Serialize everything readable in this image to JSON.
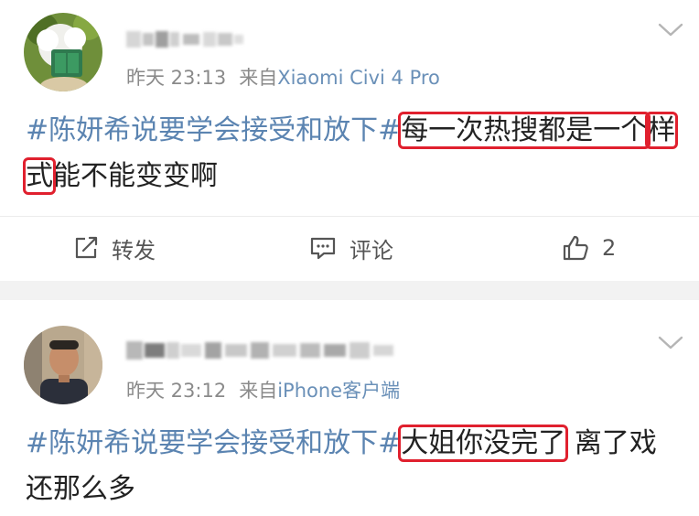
{
  "posts": [
    {
      "time": "昨天 23:13",
      "source_prefix": "来自",
      "source": "Xiaomi Civi 4 Pro",
      "hashtag": "#陈妍希说要学会接受和放下#",
      "text_part1": "每一次热搜都是一个",
      "text_part2": "样式",
      "text_part3": "能不能变变啊",
      "actions": {
        "repost": "转发",
        "comment": "评论",
        "like_count": "2"
      }
    },
    {
      "time": "昨天 23:12",
      "source_prefix": "来自",
      "source": "iPhone客户端",
      "hashtag": "#陈妍希说要学会接受和放下#",
      "text_part1": "大姐你没完了",
      "text_part2": " 离了戏还那么多"
    }
  ],
  "colors": {
    "hashtag": "#5b84b1",
    "highlight_box": "#e0202e",
    "separator": "#f2f2f2",
    "meta": "#8a8a8a"
  },
  "icons": [
    "repost-icon",
    "comment-icon",
    "like-icon",
    "chevron-down-icon"
  ]
}
